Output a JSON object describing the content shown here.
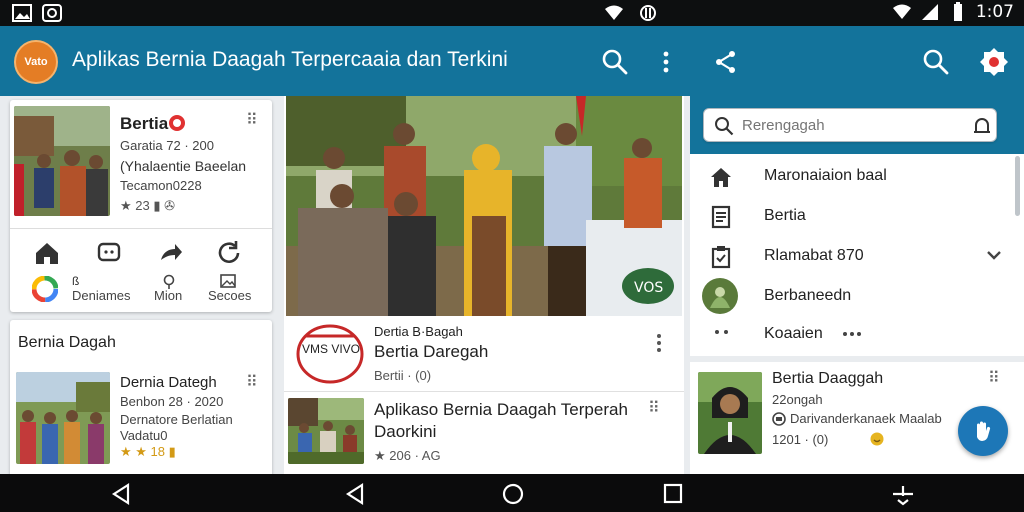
{
  "status_bar": {
    "time": "1:07",
    "icons": [
      "image-icon",
      "whatsapp-icon",
      "wifi-icon",
      "cellular-icon",
      "battery-icon"
    ]
  },
  "app_bar": {
    "logo_text": "Vato",
    "title": "Aplikas Bernia Daagah Terpercaaia dan Terkini",
    "icons": [
      "search-icon",
      "more-vert-icon",
      "share-icon",
      "search-icon",
      "notification-icon"
    ]
  },
  "left_column": {
    "card1": {
      "title": "Bertia",
      "line1": "Garatia 72 · 200",
      "line2": "(Yhalaentie Baeelan",
      "line3": "Tecamon0228",
      "meta": "★ 23 ▮ ✇",
      "actions": [
        "home-icon",
        "chat-icon",
        "share-icon",
        "refresh-icon"
      ],
      "links": [
        {
          "icon": "google-icon",
          "label": "Deniames"
        },
        {
          "icon": "pin-icon",
          "label": "Mion"
        },
        {
          "icon": "gallery-icon",
          "label": "Secoes"
        }
      ]
    },
    "card2": {
      "section_title": "Bernia Dagah",
      "title": "Dernia Dategh",
      "line1": "Benbon 28 · 2020",
      "line2": "Dernatore Berlatian",
      "line3": "Vadatu0",
      "meta": "★ ★ 18 ▮"
    }
  },
  "middle_column": {
    "hero_badge": "VOS",
    "item1": {
      "badge": "VMS VIVO",
      "kicker": "Dertia B·Bagah",
      "title": "Bertia Daregah",
      "meta": "Bertii · (0)"
    },
    "item2": {
      "title_line1": "Aplikaso Bernia Daagah Terperah",
      "title_line2": "Daorkini",
      "meta": "★ 206 · AG"
    }
  },
  "right_column": {
    "search": {
      "placeholder": "Rerengagah"
    },
    "menu": [
      {
        "icon": "home-icon",
        "label": "Maronaiaion baal"
      },
      {
        "icon": "article-icon",
        "label": "Bertia"
      },
      {
        "icon": "clipboard-icon",
        "label": "Rlamabat 870"
      },
      {
        "icon": "avatar-icon",
        "label": "Berbaneedn"
      },
      {
        "icon": "ellipsis-icon",
        "label": "Koaaien"
      }
    ],
    "featured": {
      "title": "Bertia Daaggah",
      "line1": "22ongah",
      "line2": "Darivanderkanaek Maalab",
      "meta": "1201 · (0)"
    }
  },
  "colors": {
    "app_bar": "#13739b",
    "accent": "#1d77b7",
    "logo": "#e47d25",
    "star": "#e6b420"
  }
}
